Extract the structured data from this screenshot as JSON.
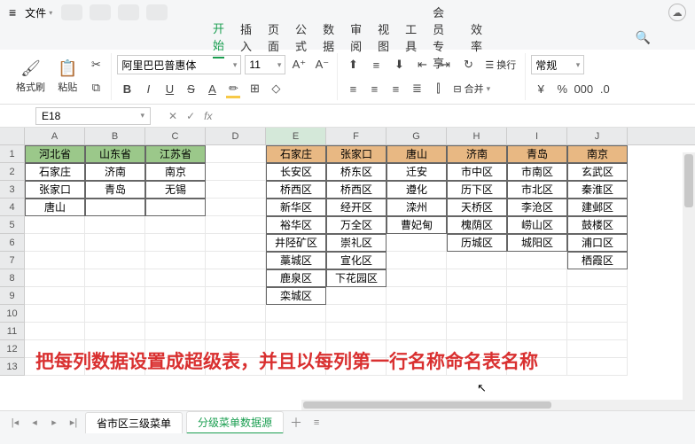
{
  "titlebar": {
    "file": "文件"
  },
  "menubar": {
    "items": [
      "开始",
      "插入",
      "页面",
      "公式",
      "数据",
      "审阅",
      "视图",
      "工具",
      "会员专享",
      "效率"
    ],
    "active_index": 0
  },
  "ribbon": {
    "format_brush": "格式刷",
    "paste": "粘贴",
    "font_name": "阿里巴巴普惠体",
    "font_size": "11",
    "bold": "B",
    "italic": "I",
    "underline": "U",
    "strike": "S",
    "font_color_label": "A",
    "wrap": "换行",
    "merge": "合并",
    "number_format": "常规",
    "currency": "¥",
    "percent": "%"
  },
  "namebox": {
    "value": "E18"
  },
  "formula": {
    "fx": "fx"
  },
  "columns": [
    "A",
    "B",
    "C",
    "D",
    "E",
    "F",
    "G",
    "H",
    "I",
    "J"
  ],
  "rows": [
    "1",
    "2",
    "3",
    "4",
    "5",
    "6",
    "7",
    "8",
    "9",
    "10",
    "11",
    "12",
    "13"
  ],
  "left_table": {
    "headers": [
      "河北省",
      "山东省",
      "江苏省"
    ],
    "rows": [
      [
        "石家庄",
        "济南",
        "南京"
      ],
      [
        "张家口",
        "青岛",
        "无锡"
      ],
      [
        "唐山",
        "",
        ""
      ]
    ]
  },
  "right_table": {
    "headers": [
      "石家庄",
      "张家口",
      "唐山",
      "济南",
      "青岛",
      "南京"
    ],
    "rows": [
      [
        "长安区",
        "桥东区",
        "迁安",
        "市中区",
        "市南区",
        "玄武区"
      ],
      [
        "桥西区",
        "桥西区",
        "遵化",
        "历下区",
        "市北区",
        "秦淮区"
      ],
      [
        "新华区",
        "经开区",
        "滦州",
        "天桥区",
        "李沧区",
        "建邺区"
      ],
      [
        "裕华区",
        "万全区",
        "曹妃甸",
        "槐荫区",
        "崂山区",
        "鼓楼区"
      ],
      [
        "井陉矿区",
        "崇礼区",
        "",
        "历城区",
        "城阳区",
        "浦口区"
      ],
      [
        "藁城区",
        "宣化区",
        "",
        "",
        "",
        "栖霞区"
      ],
      [
        "鹿泉区",
        "下花园区",
        "",
        "",
        "",
        ""
      ],
      [
        "栾城区",
        "",
        "",
        "",
        "",
        ""
      ]
    ]
  },
  "annotation": "把每列数据设置成超级表，并且以每列第一行名称命名表名称",
  "sheets": {
    "items": [
      "省市区三级菜单",
      "分级菜单数据源"
    ],
    "active_index": 1
  },
  "chart_data": null
}
